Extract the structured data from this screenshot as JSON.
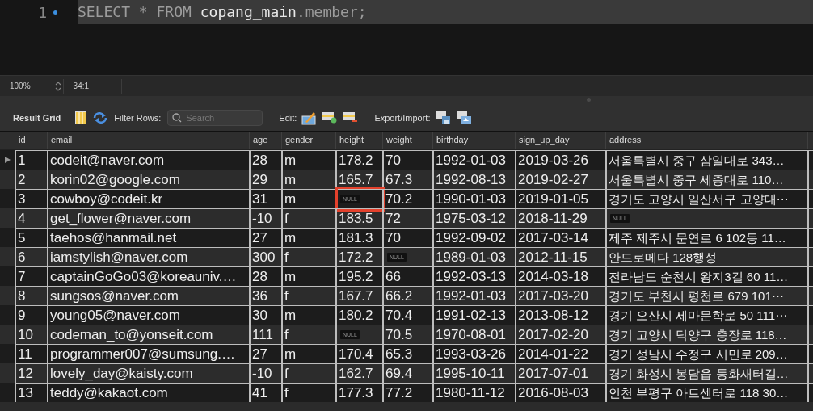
{
  "editor": {
    "line_number": "1",
    "query": [
      {
        "text": "SELECT * FROM ",
        "kind": "keyword"
      },
      {
        "text": "copang_main",
        "kind": "identifier"
      },
      {
        "text": ".member;",
        "kind": "keyword"
      }
    ]
  },
  "status_bar": {
    "zoom": "100%",
    "position": "34:1"
  },
  "toolbar": {
    "title": "Result Grid",
    "filter_label": "Filter Rows:",
    "search": {
      "placeholder": "Search"
    },
    "edit_label": "Edit:",
    "export_label": "Export/Import:"
  },
  "table": {
    "columns": [
      "id",
      "email",
      "age",
      "gender",
      "height",
      "weight",
      "birthday",
      "sign_up_day",
      "address"
    ],
    "rows": [
      {
        "current": true,
        "cells": [
          "1",
          "codeit@naver.com",
          "28",
          "m",
          "178.2",
          "70",
          "1992-01-03",
          "2019-03-26",
          "서울특별시 중구 삼일대로 343…"
        ]
      },
      {
        "current": false,
        "cells": [
          "2",
          "korin02@google.com",
          "29",
          "m",
          "165.7",
          "67.3",
          "1992-08-13",
          "2019-02-27",
          "서울특별시 중구 세종대로 110…"
        ]
      },
      {
        "current": false,
        "cells": [
          "3",
          "cowboy@codeit.kr",
          "31",
          "m",
          {
            "text": "NULL",
            "kind": "null-outlined"
          },
          "70.2",
          "1990-01-03",
          "2019-01-05",
          "경기도 고양시 일산서구 고양대⋯"
        ]
      },
      {
        "current": false,
        "cells": [
          "4",
          "get_flower@naver.com",
          "-10",
          "f",
          "183.5",
          "72",
          "1975-03-12",
          "2018-11-29",
          {
            "text": "NULL",
            "kind": "null"
          }
        ]
      },
      {
        "current": false,
        "cells": [
          "5",
          "taehos@hanmail.net",
          "27",
          "m",
          "181.3",
          "70",
          "1992-09-02",
          "2017-03-14",
          "제주 제주시 문연로 6 102동 11…"
        ]
      },
      {
        "current": false,
        "cells": [
          "6",
          "iamstylish@naver.com",
          "300",
          "f",
          "172.2",
          {
            "text": "NULL",
            "kind": "null"
          },
          "1989-01-03",
          "2012-11-15",
          "안드로메다 128행성"
        ]
      },
      {
        "current": false,
        "cells": [
          "7",
          "captainGoGo03@koreauniv.…",
          "28",
          "m",
          "195.2",
          "66",
          "1992-03-13",
          "2014-03-18",
          "전라남도 순천시 왕지3길 60 11…"
        ]
      },
      {
        "current": false,
        "cells": [
          "8",
          "sungsos@naver.com",
          "36",
          "f",
          "167.7",
          "66.2",
          "1992-01-03",
          "2017-03-20",
          "경기도 부천시 평천로 679 101⋯"
        ]
      },
      {
        "current": false,
        "cells": [
          "9",
          "young05@naver.com",
          "30",
          "m",
          "180.2",
          "70.4",
          "1991-02-13",
          "2013-08-12",
          "경기 오산시 세마문학로 50 111⋯"
        ]
      },
      {
        "current": false,
        "cells": [
          "10",
          "codeman_to@yonseit.com",
          "111",
          "f",
          {
            "text": "NULL",
            "kind": "null"
          },
          "70.5",
          "1970-08-01",
          "2017-02-20",
          "경기 고양시 덕양구 충장로 118…"
        ]
      },
      {
        "current": false,
        "cells": [
          "11",
          "programmer007@sumsung.…",
          "27",
          "m",
          "170.4",
          "65.3",
          "1993-03-26",
          "2014-01-22",
          "경기 성남시 수정구 시민로 209…"
        ]
      },
      {
        "current": false,
        "cells": [
          "12",
          "lovely_day@kaisty.com",
          "-10",
          "f",
          "162.7",
          "69.4",
          "1995-10-11",
          "2017-07-01",
          "경기 화성시 봉담읍 동화새터길…"
        ]
      },
      {
        "current": false,
        "cells": [
          "13",
          "teddy@kakaot.com",
          "41",
          "f",
          "177.3",
          "77.2",
          "1980-11-12",
          "2016-08-03",
          "인천 부평구 아트센터로 118 30…"
        ]
      }
    ]
  }
}
